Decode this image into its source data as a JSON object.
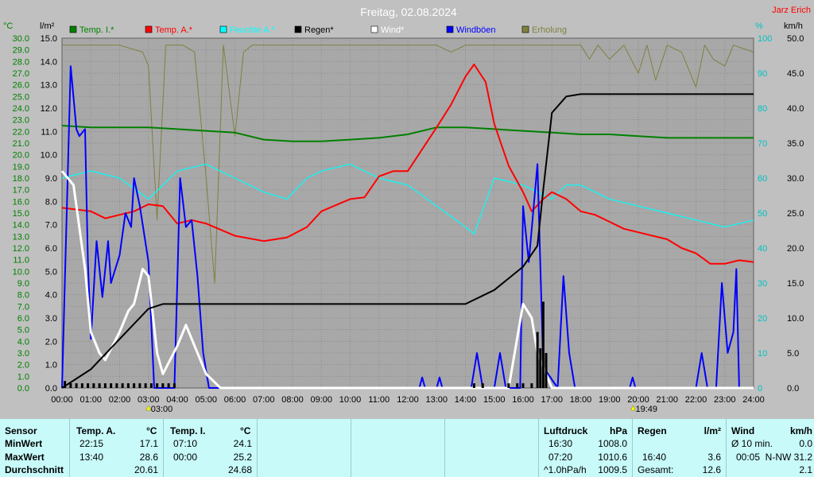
{
  "chart_data": {
    "type": "line",
    "title": "Freitag, 02.08.2024",
    "author": "Jarz Erich",
    "x_ticks": [
      "00:00",
      "01:00",
      "02:00",
      "03:00",
      "04:00",
      "05:00",
      "06:00",
      "07:00",
      "08:00",
      "09:00",
      "10:00",
      "11:00",
      "12:00",
      "13:00",
      "14:00",
      "15:00",
      "16:00",
      "17:00",
      "18:00",
      "19:00",
      "20:00",
      "21:00",
      "22:00",
      "23:00",
      "24:00"
    ],
    "sun_markers": [
      {
        "label": "03:00",
        "hour": 3.0
      },
      {
        "label": "19:49",
        "hour": 19.82
      }
    ],
    "axes": {
      "temp": {
        "unit": "°C",
        "range": [
          10,
          30
        ],
        "ticks": [
          "30.0",
          "29.0",
          "28.0",
          "27.0",
          "26.0",
          "25.0",
          "24.0",
          "23.0",
          "22.0",
          "21.0",
          "20.0",
          "19.0",
          "18.0",
          "17.0",
          "16.0",
          "15.0",
          "14.0",
          "13.0",
          "12.0",
          "11.0",
          "10.0",
          "9.0",
          "8.0",
          "7.0",
          "6.0",
          "5.0",
          "4.0",
          "3.0",
          "2.0",
          "1.0",
          "0.0"
        ]
      },
      "rain": {
        "unit": "l/m²",
        "range": [
          0,
          15
        ],
        "ticks": [
          "15.0",
          "14.0",
          "13.0",
          "12.0",
          "11.0",
          "10.0",
          "9.0",
          "8.0",
          "7.0",
          "6.0",
          "5.0",
          "4.0",
          "3.0",
          "2.0",
          "1.0",
          "0.0"
        ]
      },
      "humidity": {
        "unit": "%",
        "range": [
          50,
          100
        ],
        "ticks": [
          "100",
          "90",
          "80",
          "70",
          "60",
          "50",
          "40",
          "30",
          "20",
          "10",
          "0"
        ]
      },
      "wind": {
        "unit": "km/h",
        "range": [
          0,
          50
        ],
        "ticks": [
          "50.0",
          "45.0",
          "40.0",
          "35.0",
          "30.0",
          "25.0",
          "20.0",
          "15.0",
          "10.0",
          "5.0",
          "0.0"
        ]
      }
    },
    "legend": [
      {
        "name": "Temp. I.*",
        "color": "#008000"
      },
      {
        "name": "Temp. A.*",
        "color": "#ff0000"
      },
      {
        "name": "Feuchte A.*",
        "color": "#00ffff"
      },
      {
        "name": "Regen*",
        "color": "#000000"
      },
      {
        "name": "Wind*",
        "color": "#ffffff"
      },
      {
        "name": "Windböen",
        "color": "#0000ff"
      },
      {
        "name": "Erholung",
        "color": "#808040"
      }
    ],
    "series": {
      "temp_indoor": {
        "axis": "temp",
        "color": "#008000",
        "points": [
          [
            0,
            25.0
          ],
          [
            1,
            24.9
          ],
          [
            2,
            24.9
          ],
          [
            3,
            24.9
          ],
          [
            4,
            24.8
          ],
          [
            5,
            24.7
          ],
          [
            6,
            24.6
          ],
          [
            7,
            24.2
          ],
          [
            8,
            24.1
          ],
          [
            9,
            24.1
          ],
          [
            10,
            24.2
          ],
          [
            11,
            24.3
          ],
          [
            12,
            24.5
          ],
          [
            13,
            24.9
          ],
          [
            14,
            24.9
          ],
          [
            15,
            24.8
          ],
          [
            16,
            24.7
          ],
          [
            17,
            24.6
          ],
          [
            18,
            24.5
          ],
          [
            19,
            24.5
          ],
          [
            20,
            24.4
          ],
          [
            21,
            24.3
          ],
          [
            22,
            24.3
          ],
          [
            23,
            24.3
          ],
          [
            24,
            24.3
          ]
        ]
      },
      "temp_outdoor": {
        "axis": "temp",
        "color": "#ff0000",
        "points": [
          [
            0,
            20.3
          ],
          [
            1,
            20.1
          ],
          [
            1.5,
            19.7
          ],
          [
            2,
            19.9
          ],
          [
            2.5,
            20.1
          ],
          [
            3,
            20.5
          ],
          [
            3.5,
            20.4
          ],
          [
            4,
            19.4
          ],
          [
            4.5,
            19.6
          ],
          [
            5,
            19.4
          ],
          [
            6,
            18.7
          ],
          [
            7,
            18.4
          ],
          [
            7.8,
            18.6
          ],
          [
            8.5,
            19.2
          ],
          [
            9,
            20.1
          ],
          [
            10,
            20.8
          ],
          [
            10.5,
            20.9
          ],
          [
            11,
            22.1
          ],
          [
            11.5,
            22.4
          ],
          [
            12,
            22.4
          ],
          [
            13,
            24.9
          ],
          [
            13.5,
            26.2
          ],
          [
            14,
            27.8
          ],
          [
            14.3,
            28.5
          ],
          [
            14.7,
            27.5
          ],
          [
            15,
            25.1
          ],
          [
            15.5,
            22.7
          ],
          [
            16,
            21.2
          ],
          [
            16.3,
            20.1
          ],
          [
            16.7,
            20.8
          ],
          [
            17,
            21.2
          ],
          [
            17.5,
            20.8
          ],
          [
            18,
            20.1
          ],
          [
            18.5,
            19.9
          ],
          [
            19,
            19.5
          ],
          [
            19.5,
            19.1
          ],
          [
            20,
            18.9
          ],
          [
            21,
            18.5
          ],
          [
            21.5,
            18.0
          ],
          [
            22,
            17.7
          ],
          [
            22.5,
            17.1
          ],
          [
            23,
            17.1
          ],
          [
            23.5,
            17.3
          ],
          [
            24,
            17.2
          ]
        ]
      },
      "humidity": {
        "axis": "humidity",
        "color": "#00ffff",
        "points": [
          [
            0,
            80
          ],
          [
            1,
            81
          ],
          [
            2,
            80
          ],
          [
            3,
            77
          ],
          [
            4,
            81
          ],
          [
            5,
            82
          ],
          [
            6,
            80
          ],
          [
            7,
            78
          ],
          [
            7.8,
            77
          ],
          [
            8.5,
            80
          ],
          [
            9,
            81
          ],
          [
            10,
            82
          ],
          [
            11,
            80
          ],
          [
            12,
            79
          ],
          [
            13,
            76
          ],
          [
            14,
            73
          ],
          [
            14.3,
            72
          ],
          [
            15,
            80
          ],
          [
            16,
            79
          ],
          [
            17,
            77
          ],
          [
            17.5,
            79
          ],
          [
            18,
            79
          ],
          [
            19,
            77
          ],
          [
            20,
            76
          ],
          [
            21,
            75
          ],
          [
            22,
            74
          ],
          [
            23,
            73
          ],
          [
            24,
            74
          ]
        ]
      },
      "rain": {
        "axis": "rain",
        "color": "#000000",
        "points": [
          [
            0,
            0
          ],
          [
            1,
            0.8
          ],
          [
            2,
            2.1
          ],
          [
            3,
            3.4
          ],
          [
            3.5,
            3.6
          ],
          [
            12,
            3.6
          ],
          [
            14,
            3.6
          ],
          [
            15,
            4.2
          ],
          [
            16,
            5.2
          ],
          [
            16.5,
            6.1
          ],
          [
            16.7,
            8.5
          ],
          [
            17,
            11.8
          ],
          [
            17.5,
            12.5
          ],
          [
            18,
            12.6
          ],
          [
            24,
            12.6
          ]
        ]
      },
      "wind": {
        "axis": "wind",
        "color": "#ffffff",
        "points": [
          [
            0,
            31
          ],
          [
            0.4,
            29
          ],
          [
            0.8,
            17
          ],
          [
            1,
            8
          ],
          [
            1.3,
            5
          ],
          [
            1.5,
            4
          ],
          [
            2,
            8
          ],
          [
            2.3,
            11
          ],
          [
            2.5,
            12
          ],
          [
            2.8,
            17
          ],
          [
            3,
            16
          ],
          [
            3.3,
            5
          ],
          [
            3.5,
            2
          ],
          [
            4,
            6
          ],
          [
            4.3,
            9
          ],
          [
            4.6,
            6
          ],
          [
            5,
            2
          ],
          [
            5.5,
            0
          ],
          [
            15.5,
            0
          ],
          [
            16,
            12
          ],
          [
            16.3,
            10
          ],
          [
            16.5,
            5
          ],
          [
            17,
            0
          ],
          [
            24,
            0
          ]
        ]
      },
      "gusts": {
        "axis": "wind",
        "color": "#0000ff",
        "points": [
          [
            0,
            0
          ],
          [
            0.3,
            46
          ],
          [
            0.5,
            37
          ],
          [
            0.6,
            36
          ],
          [
            0.8,
            37
          ],
          [
            0.9,
            18
          ],
          [
            1,
            7
          ],
          [
            1.2,
            21
          ],
          [
            1.4,
            13
          ],
          [
            1.6,
            21
          ],
          [
            1.7,
            15
          ],
          [
            2,
            19
          ],
          [
            2.2,
            25
          ],
          [
            2.4,
            23
          ],
          [
            2.5,
            30
          ],
          [
            2.7,
            26
          ],
          [
            3,
            18
          ],
          [
            3.2,
            0
          ],
          [
            3.9,
            0
          ],
          [
            4.1,
            30
          ],
          [
            4.3,
            23
          ],
          [
            4.5,
            24
          ],
          [
            4.7,
            16
          ],
          [
            4.9,
            5
          ],
          [
            5.1,
            0
          ],
          [
            12.4,
            0
          ],
          [
            12.5,
            1.5
          ],
          [
            12.6,
            0
          ],
          [
            13,
            0
          ],
          [
            13.1,
            1.5
          ],
          [
            13.2,
            0
          ],
          [
            14.2,
            0
          ],
          [
            14.4,
            5
          ],
          [
            14.6,
            0
          ],
          [
            15,
            0
          ],
          [
            15.2,
            5
          ],
          [
            15.4,
            0
          ],
          [
            15.9,
            0
          ],
          [
            16,
            26
          ],
          [
            16.2,
            18
          ],
          [
            16.5,
            32
          ],
          [
            16.7,
            3
          ],
          [
            17.2,
            0
          ],
          [
            17.4,
            16
          ],
          [
            17.6,
            5
          ],
          [
            17.8,
            0
          ],
          [
            19.7,
            0
          ],
          [
            19.8,
            1.5
          ],
          [
            19.9,
            0
          ],
          [
            22,
            0
          ],
          [
            22.2,
            5
          ],
          [
            22.4,
            0
          ],
          [
            22.7,
            0
          ],
          [
            22.9,
            15
          ],
          [
            23.1,
            5
          ],
          [
            23.3,
            8
          ],
          [
            23.4,
            17
          ],
          [
            23.5,
            0
          ],
          [
            24,
            0
          ]
        ]
      },
      "recovery": {
        "axis": "humidity",
        "color": "#808040",
        "points": [
          [
            0,
            99
          ],
          [
            2,
            99
          ],
          [
            2.8,
            98
          ],
          [
            3,
            96
          ],
          [
            3.3,
            74
          ],
          [
            3.6,
            99
          ],
          [
            4.2,
            99
          ],
          [
            4.6,
            98
          ],
          [
            5,
            80
          ],
          [
            5.3,
            65
          ],
          [
            5.6,
            99
          ],
          [
            6,
            86
          ],
          [
            6.3,
            98
          ],
          [
            6.6,
            99
          ],
          [
            13,
            99
          ],
          [
            13.5,
            98
          ],
          [
            14,
            99
          ],
          [
            18,
            99
          ],
          [
            18.3,
            97
          ],
          [
            18.6,
            99
          ],
          [
            19,
            97
          ],
          [
            19.5,
            99
          ],
          [
            20,
            95
          ],
          [
            20.3,
            99
          ],
          [
            20.6,
            94
          ],
          [
            21,
            99
          ],
          [
            21.5,
            98
          ],
          [
            22,
            93
          ],
          [
            22.3,
            99
          ],
          [
            22.6,
            97
          ],
          [
            23,
            96
          ],
          [
            23.3,
            99
          ],
          [
            24,
            98
          ]
        ]
      },
      "rain_bars": {
        "axis": "rain",
        "color": "#000000",
        "hours": [
          0.1,
          0.3,
          0.5,
          0.7,
          0.9,
          1.1,
          1.3,
          1.5,
          1.7,
          1.9,
          2.1,
          2.3,
          2.5,
          2.7,
          2.9,
          3.1,
          3.3,
          3.5,
          3.7,
          3.9,
          14.3,
          14.6,
          15.5,
          15.8,
          16.0,
          16.3,
          16.5,
          16.6,
          16.7,
          16.8
        ],
        "values": [
          0.3,
          0.2,
          0.2,
          0.2,
          0.2,
          0.2,
          0.2,
          0.2,
          0.2,
          0.2,
          0.2,
          0.2,
          0.2,
          0.2,
          0.2,
          0.2,
          0.2,
          0.2,
          0.2,
          0.2,
          0.2,
          0.2,
          0.2,
          0.2,
          0.2,
          0.2,
          2.4,
          1.7,
          3.7,
          1.5
        ]
      }
    }
  },
  "summary": {
    "headers": {
      "sensor": "Sensor",
      "temp_a": "Temp. A.",
      "temp_a_unit": "°C",
      "temp_i": "Temp. I.",
      "temp_i_unit": "°C",
      "pressure": "Luftdruck",
      "pressure_unit": "hPa",
      "rain": "Regen",
      "rain_unit": "l/m²",
      "wind": "Wind",
      "wind_unit": "km/h"
    },
    "rows": {
      "min": "MinWert",
      "max": "MaxWert",
      "avg": "Durchschnitt"
    },
    "temp_a": {
      "min_time": "22:15",
      "min_val": "17.1",
      "max_time": "13:40",
      "max_val": "28.6",
      "avg": "20.61"
    },
    "temp_i": {
      "min_time": "07:10",
      "min_val": "24.1",
      "max_time": "00:00",
      "max_val": "25.2",
      "avg": "24.68"
    },
    "pressure": {
      "r1_time": "16:30",
      "r1_val": "1008.0",
      "r2_time": "07:20",
      "r2_val": "1010.6",
      "r3_label": "^1.0hPa/h",
      "r3_val": "1009.5"
    },
    "rain": {
      "r2_time": "16:40",
      "r2_val": "3.6",
      "r3_label": "Gesamt:",
      "r3_val": "12.6"
    },
    "wind": {
      "r1_label": "Ø 10 min.",
      "r1_val": "0.0",
      "r2_time": "00:05",
      "r2_val": "N-NW 31.2",
      "r3_val": "2.1"
    }
  }
}
